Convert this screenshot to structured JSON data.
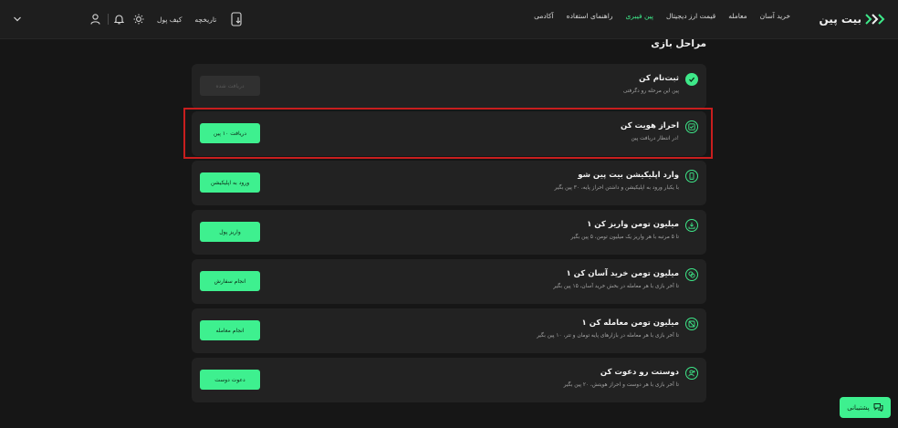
{
  "brand": {
    "name": "بیت پین"
  },
  "nav": {
    "items": [
      {
        "label": "خرید آسان",
        "active": false
      },
      {
        "label": "معامله",
        "active": false
      },
      {
        "label": "قیمت ارز دیجیتال",
        "active": false
      },
      {
        "label": "پین فیبری",
        "active": true
      },
      {
        "label": "راهنمای استفاده",
        "active": false
      },
      {
        "label": "آکادمی",
        "active": false
      }
    ]
  },
  "toolbar": {
    "wallet_label": "کیف پول",
    "history_label": "تاریخچه",
    "icons": [
      "chevron-down-icon",
      "user-icon",
      "bell-icon",
      "sun-icon",
      "phone-download-icon"
    ]
  },
  "page": {
    "title": "مراحل بازی"
  },
  "steps": [
    {
      "title": "ثبت‌نام کن",
      "desc": "پین این مرحله رو دگرفتی",
      "action": "دریافت شده",
      "done": true,
      "icon": "check-icon"
    },
    {
      "title": "احراز هویت کن",
      "desc": "در انتظار دریافت پین!",
      "action": "دریافت ۱۰ پین",
      "done": false,
      "icon": "id-card-icon"
    },
    {
      "title": "وارد اپلیکیشن بیت پین شو",
      "desc": "با یکبار ورود به اپلیکیشن و داشتن احراز پایه، ۳۰ پین بگیر",
      "action": "ورود به اپلیکیشن",
      "done": false,
      "icon": "mobile-icon"
    },
    {
      "title": "۱ میلیون تومن واریز کن",
      "desc": "تا ۵ مرتبه با هر واریز یک میلیون تومن، ۵ پین بگیر",
      "action": "واریز پول",
      "done": false,
      "icon": "deposit-icon"
    },
    {
      "title": "۱ میلیون تومن خرید آسان کن",
      "desc": "تا آخر بازی با هر معامله در بخش خرید آسان، ۱۵ پین بگیر",
      "action": "انجام سفارش",
      "done": false,
      "icon": "exchange-icon"
    },
    {
      "title": "۱ میلیون تومن معامله کن",
      "desc": "تا آخر بازی با هر معامله در بازارهای پایه تومان و تتر، ۱۰ پین بگیر",
      "action": "انجام معامله",
      "done": false,
      "icon": "trade-icon"
    },
    {
      "title": "دوستت رو دعوت کن",
      "desc": "تا آخر بازی با هر دوست و احراز هویتش، ۲۰ پین بگیر",
      "action": "دعوت دوست",
      "done": false,
      "icon": "invite-friend-icon"
    }
  ],
  "support": {
    "label": "پشتیبانی",
    "icon": "chat-icon"
  },
  "colors": {
    "accent": "#3ef08f",
    "background": "#161616",
    "card": "#222222",
    "highlight": "#c81e1e"
  }
}
